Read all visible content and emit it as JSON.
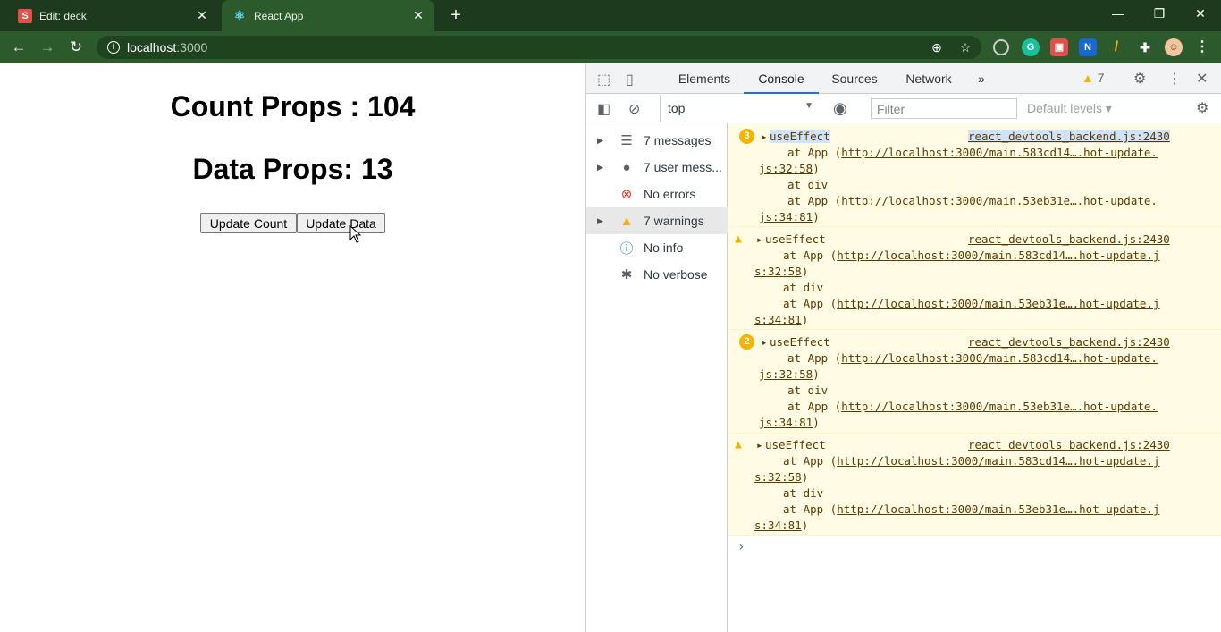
{
  "browser": {
    "tabs": [
      {
        "title": "Edit: deck",
        "favicon": "S"
      },
      {
        "title": "React App",
        "favicon": "⚛"
      }
    ],
    "url_host": "localhost",
    "url_port": ":3000"
  },
  "page": {
    "count_heading": "Count Props : 104",
    "data_heading": "Data Props: 13",
    "update_count_label": "Update Count",
    "update_data_label": "Update Data"
  },
  "devtools": {
    "tabs": [
      "Elements",
      "Console",
      "Sources",
      "Network"
    ],
    "more_tabs": "»",
    "warning_count": "7",
    "context": "top",
    "filter_placeholder": "Filter",
    "levels_label": "Default levels ▾",
    "sidebar": [
      {
        "label": "7 messages"
      },
      {
        "label": "7 user mess..."
      },
      {
        "label": "No errors"
      },
      {
        "label": "7 warnings"
      },
      {
        "label": "No info"
      },
      {
        "label": "No verbose"
      }
    ],
    "messages": [
      {
        "badge": "3",
        "title": "useEffect",
        "source": "react_devtools_backend.js:2430",
        "l1a": "at App (",
        "l1link": "http://localhost:3000/main.583cd14….hot-update.",
        "l1b": "js:32:58",
        "l1c": ")",
        "l2": "at div",
        "l3a": "at App (",
        "l3link": "http://localhost:3000/main.53eb31e….hot-update.",
        "l3b": "js:34:81",
        "l3c": ")"
      },
      {
        "badge": "",
        "title": "useEffect",
        "source": "react_devtools_backend.js:2430",
        "l1a": "at App (",
        "l1link": "http://localhost:3000/main.583cd14….hot-update.j",
        "l1b": "s:32:58",
        "l1c": ")",
        "l2": "at div",
        "l3a": "at App (",
        "l3link": "http://localhost:3000/main.53eb31e….hot-update.j",
        "l3b": "s:34:81",
        "l3c": ")"
      },
      {
        "badge": "2",
        "title": "useEffect",
        "source": "react_devtools_backend.js:2430",
        "l1a": "at App (",
        "l1link": "http://localhost:3000/main.583cd14….hot-update.",
        "l1b": "js:32:58",
        "l1c": ")",
        "l2": "at div",
        "l3a": "at App (",
        "l3link": "http://localhost:3000/main.53eb31e….hot-update.",
        "l3b": "js:34:81",
        "l3c": ")"
      },
      {
        "badge": "",
        "title": "useEffect",
        "source": "react_devtools_backend.js:2430",
        "l1a": "at App (",
        "l1link": "http://localhost:3000/main.583cd14….hot-update.j",
        "l1b": "s:32:58",
        "l1c": ")",
        "l2": "at div",
        "l3a": "at App (",
        "l3link": "http://localhost:3000/main.53eb31e….hot-update.j",
        "l3b": "s:34:81",
        "l3c": ")"
      }
    ],
    "prompt": "›"
  },
  "colors": {
    "titlebar": "#1e3a1e",
    "toolbar": "#2c5a2c",
    "warning_bg": "#fffbe5",
    "accent": "#1a73e8",
    "warning": "#f4b400"
  }
}
